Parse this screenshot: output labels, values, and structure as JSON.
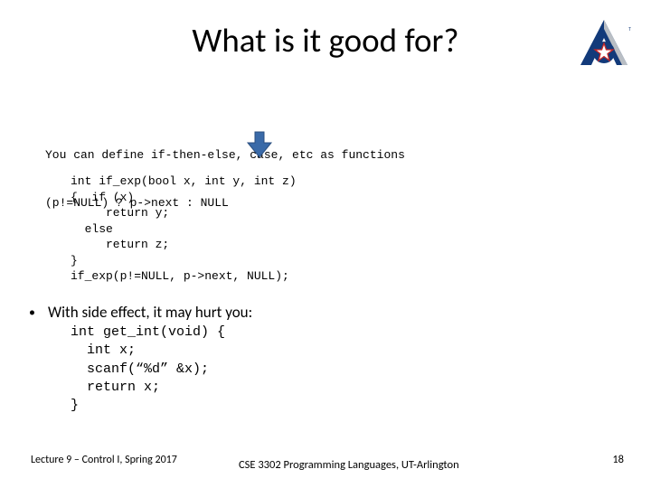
{
  "title": "What is it good for?",
  "intro_line1": "You can define if-then-else, case, etc as functions",
  "intro_line2": "(p!=NULL) ? p->next : NULL",
  "code_block1": "int if_exp(bool x, int y, int z)\n{  if (x)\n     return y;\n  else\n     return z;\n}\nif_exp(p!=NULL, p->next, NULL);",
  "bullet_text": "With side effect, it may hurt you:",
  "code_block2": "int get_int(void) {\n  int x;\n  scanf(“%d” &x);\n  return x;\n}",
  "footer": {
    "left": "Lecture 9 – Control I, Spring 2017",
    "center": "CSE 3302 Programming Languages, UT-Arlington",
    "page": "18"
  },
  "logo": {
    "name": "uta-logo",
    "accent_blue": "#123a7a",
    "accent_gray": "#b9bec4",
    "star_fill": "#ffffff",
    "star_stroke": "#c62828"
  },
  "arrow": {
    "fill": "#3a6aa8",
    "stroke": "#2a4f80"
  }
}
